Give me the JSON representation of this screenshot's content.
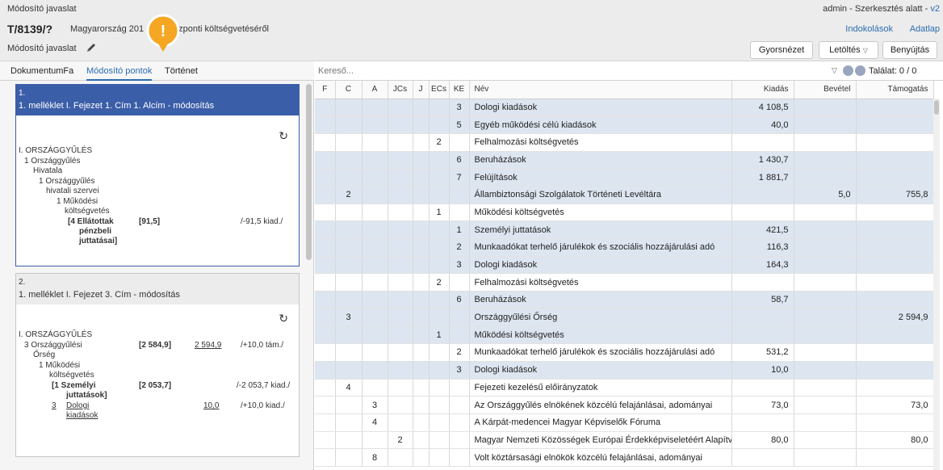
{
  "topbar": {
    "app_title": "Módosító javaslat",
    "user_status": "admin - Szerkesztés alatt - ",
    "version": "v2",
    "doc_id": "T/8139/?",
    "doc_title_a": "Magyarország 201",
    "doc_title_b": "zponti költségvetéséről",
    "link_indoklasok": "Indokolások",
    "link_adatlap": "Adatlap",
    "proposal_label": "Módosító javaslat",
    "btn_gyorsnezet": "Gyorsnézet",
    "btn_letoltes": "Letöltés",
    "btn_benyujtas": "Benyújtás",
    "alert_symbol": "!"
  },
  "left_tabs": [
    "DokumentumFa",
    "Módosító pontok",
    "Történet"
  ],
  "cards": [
    {
      "num": "1.",
      "title": "1. melléklet I. Fejezet 1. Cím 1. Alcím - módosítás",
      "undo_icon": "↻",
      "lines": [
        {
          "t": "I. ORSZÁGGYŰLÉS"
        },
        {
          "t": "1  Országgyűlés"
        },
        {
          "t": "Hivatala"
        },
        {
          "t": "1  Országgyűlés"
        },
        {
          "t": "hivatali szervei"
        },
        {
          "t": "1  Működési"
        },
        {
          "t": "költségvetés"
        },
        {
          "t": "[4  Ellátottak"
        },
        {
          "t": "pénzbeli"
        },
        {
          "t": "juttatásai]"
        },
        {
          "t": "[91,5]"
        },
        {
          "t": "/-91,5 kiad./"
        }
      ]
    },
    {
      "num": "2.",
      "title": "1. melléklet I. Fejezet 3. Cím - módosítás",
      "undo_icon": "↻",
      "lines": [
        {
          "t": "I. ORSZÁGGYŰLÉS"
        },
        {
          "t": "3  Országgyűlési"
        },
        {
          "t": "Őrség"
        },
        {
          "t": "[2 584,9]"
        },
        {
          "t": "2 594,9"
        },
        {
          "t": "/+10,0 tám./"
        },
        {
          "t": "1  Működési"
        },
        {
          "t": "költségvetés"
        },
        {
          "t": "[1  Személyi"
        },
        {
          "t": "juttatások]"
        },
        {
          "t": "[2 053,7]"
        },
        {
          "t": "/-2 053,7 kiad./"
        },
        {
          "t": "3"
        },
        {
          "t": "Dologi"
        },
        {
          "t": "kiadások"
        },
        {
          "t": "10,0"
        },
        {
          "t": "/+10,0 kiad./"
        }
      ]
    }
  ],
  "search": {
    "placeholder": "Kereső...",
    "hits": "Találat: 0 / 0"
  },
  "table": {
    "headers": [
      "F",
      "C",
      "A",
      "JCs",
      "J",
      "ECs",
      "KE",
      "Név",
      "Kiadás",
      "Bevétel",
      "Támogatás"
    ],
    "rows": [
      {
        "f": "",
        "c": "",
        "a": "",
        "jcs": "",
        "j": "",
        "ecs": "",
        "ke": "3",
        "nev": "Dologi kiadások",
        "kiadas": "4 108,5",
        "bevetel": "",
        "tamogatas": ""
      },
      {
        "f": "",
        "c": "",
        "a": "",
        "jcs": "",
        "j": "",
        "ecs": "",
        "ke": "5",
        "nev": "Egyéb működési célú kiadások",
        "kiadas": "40,0",
        "bevetel": "",
        "tamogatas": ""
      },
      {
        "f": "",
        "c": "",
        "a": "",
        "jcs": "",
        "j": "",
        "ecs": "2",
        "ke": "",
        "nev": "Felhalmozási költségvetés",
        "kiadas": "",
        "bevetel": "",
        "tamogatas": ""
      },
      {
        "f": "",
        "c": "",
        "a": "",
        "jcs": "",
        "j": "",
        "ecs": "",
        "ke": "6",
        "nev": "Beruházások",
        "kiadas": "1 430,7",
        "bevetel": "",
        "tamogatas": ""
      },
      {
        "f": "",
        "c": "",
        "a": "",
        "jcs": "",
        "j": "",
        "ecs": "",
        "ke": "7",
        "nev": "Felújítások",
        "kiadas": "1 881,7",
        "bevetel": "",
        "tamogatas": ""
      },
      {
        "f": "",
        "c": "2",
        "a": "",
        "jcs": "",
        "j": "",
        "ecs": "",
        "ke": "",
        "nev": "Állambiztonsági Szolgálatok Történeti Levéltára",
        "kiadas": "",
        "bevetel": "5,0",
        "tamogatas": "755,8"
      },
      {
        "f": "",
        "c": "",
        "a": "",
        "jcs": "",
        "j": "",
        "ecs": "1",
        "ke": "",
        "nev": "Működési költségvetés",
        "kiadas": "",
        "bevetel": "",
        "tamogatas": ""
      },
      {
        "f": "",
        "c": "",
        "a": "",
        "jcs": "",
        "j": "",
        "ecs": "",
        "ke": "1",
        "nev": "Személyi juttatások",
        "kiadas": "421,5",
        "bevetel": "",
        "tamogatas": ""
      },
      {
        "f": "",
        "c": "",
        "a": "",
        "jcs": "",
        "j": "",
        "ecs": "",
        "ke": "2",
        "nev": "Munkaadókat terhelő járulékok és szociális hozzájárulási adó",
        "kiadas": "116,3",
        "bevetel": "",
        "tamogatas": ""
      },
      {
        "f": "",
        "c": "",
        "a": "",
        "jcs": "",
        "j": "",
        "ecs": "",
        "ke": "3",
        "nev": "Dologi kiadások",
        "kiadas": "164,3",
        "bevetel": "",
        "tamogatas": ""
      },
      {
        "f": "",
        "c": "",
        "a": "",
        "jcs": "",
        "j": "",
        "ecs": "2",
        "ke": "",
        "nev": "Felhalmozási költségvetés",
        "kiadas": "",
        "bevetel": "",
        "tamogatas": ""
      },
      {
        "f": "",
        "c": "",
        "a": "",
        "jcs": "",
        "j": "",
        "ecs": "",
        "ke": "6",
        "nev": "Beruházások",
        "kiadas": "58,7",
        "bevetel": "",
        "tamogatas": ""
      },
      {
        "f": "",
        "c": "3",
        "a": "",
        "jcs": "",
        "j": "",
        "ecs": "",
        "ke": "",
        "nev": "Országgyűlési Őrség",
        "kiadas": "",
        "bevetel": "",
        "tamogatas": "2 594,9"
      },
      {
        "f": "",
        "c": "",
        "a": "",
        "jcs": "",
        "j": "",
        "ecs": "1",
        "ke": "",
        "nev": "Működési költségvetés",
        "kiadas": "",
        "bevetel": "",
        "tamogatas": ""
      },
      {
        "f": "",
        "c": "",
        "a": "",
        "jcs": "",
        "j": "",
        "ecs": "",
        "ke": "2",
        "nev": "Munkaadókat terhelő járulékok és szociális hozzájárulási adó",
        "kiadas": "531,2",
        "bevetel": "",
        "tamogatas": ""
      },
      {
        "f": "",
        "c": "",
        "a": "",
        "jcs": "",
        "j": "",
        "ecs": "",
        "ke": "3",
        "nev": "Dologi kiadások",
        "kiadas": "10,0",
        "bevetel": "",
        "tamogatas": ""
      },
      {
        "f": "",
        "c": "4",
        "a": "",
        "jcs": "",
        "j": "",
        "ecs": "",
        "ke": "",
        "nev": "Fejezeti kezelésű előirányzatok",
        "kiadas": "",
        "bevetel": "",
        "tamogatas": ""
      },
      {
        "f": "",
        "c": "",
        "a": "3",
        "jcs": "",
        "j": "",
        "ecs": "",
        "ke": "",
        "nev": "Az Országgyűlés elnökének közcélú felajánlásai, adományai",
        "kiadas": "73,0",
        "bevetel": "",
        "tamogatas": "73,0"
      },
      {
        "f": "",
        "c": "",
        "a": "4",
        "jcs": "",
        "j": "",
        "ecs": "",
        "ke": "",
        "nev": "A Kárpát-medencei Magyar Képviselők Fóruma",
        "kiadas": "",
        "bevetel": "",
        "tamogatas": ""
      },
      {
        "f": "",
        "c": "",
        "a": "",
        "jcs": "2",
        "j": "",
        "ecs": "",
        "ke": "",
        "nev": "Magyar Nemzeti Közösségek Európai Érdekképviseletéért Alapítvány",
        "kiadas": "80,0",
        "bevetel": "",
        "tamogatas": "80,0"
      },
      {
        "f": "",
        "c": "",
        "a": "8",
        "jcs": "",
        "j": "",
        "ecs": "",
        "ke": "",
        "nev": "Volt köztársasági elnökök közcélú felajánlásai, adományai",
        "kiadas": "",
        "bevetel": "",
        "tamogatas": ""
      }
    ],
    "alt_rows": [
      0,
      1,
      3,
      4,
      5,
      7,
      8,
      9,
      11,
      12,
      13,
      15
    ]
  },
  "colors": {
    "accent": "#2b6cb0",
    "active_card": "#3b5ea8",
    "alert": "#f5a623",
    "row_alt": "#dde6f0"
  },
  "icons": {
    "pencil": "pencil-icon",
    "alert": "alert-icon",
    "undo": "undo-icon",
    "gear": "gear-icon",
    "prev": "prev-result-icon",
    "next": "next-result-icon"
  }
}
